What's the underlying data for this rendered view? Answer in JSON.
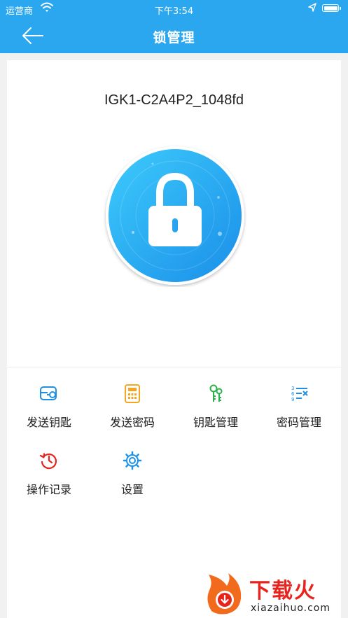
{
  "status_bar": {
    "carrier": "运营商",
    "time": "下午3:54",
    "battery_level": 1.0
  },
  "nav": {
    "title": "锁管理",
    "back_icon": "arrow-left-icon"
  },
  "lock": {
    "device_name": "IGK1-C2A4P2_1048fd",
    "icon": "padlock-icon",
    "colors": {
      "gradient_light": "#35c6fb",
      "gradient_dark": "#1a8ee8"
    }
  },
  "menu": [
    {
      "id": "send-key",
      "label": "发送钥匙",
      "icon": "key-card-icon",
      "color": "#1e90e8"
    },
    {
      "id": "send-password",
      "label": "发送密码",
      "icon": "keypad-icon",
      "color": "#f4a623"
    },
    {
      "id": "key-management",
      "label": "钥匙管理",
      "icon": "keys-icon",
      "color": "#2bb24c"
    },
    {
      "id": "password-management",
      "label": "密码管理",
      "icon": "number-list-icon",
      "color": "#1e90e8"
    },
    {
      "id": "operation-log",
      "label": "操作记录",
      "icon": "history-icon",
      "color": "#e8231c"
    },
    {
      "id": "settings",
      "label": "设置",
      "icon": "gear-icon",
      "color": "#1e90e8"
    }
  ],
  "watermark": {
    "brand": "下载火",
    "domain": "xiazaihuo.com"
  },
  "colors": {
    "primary": "#2ba7f0",
    "background": "#f1f1f1"
  }
}
